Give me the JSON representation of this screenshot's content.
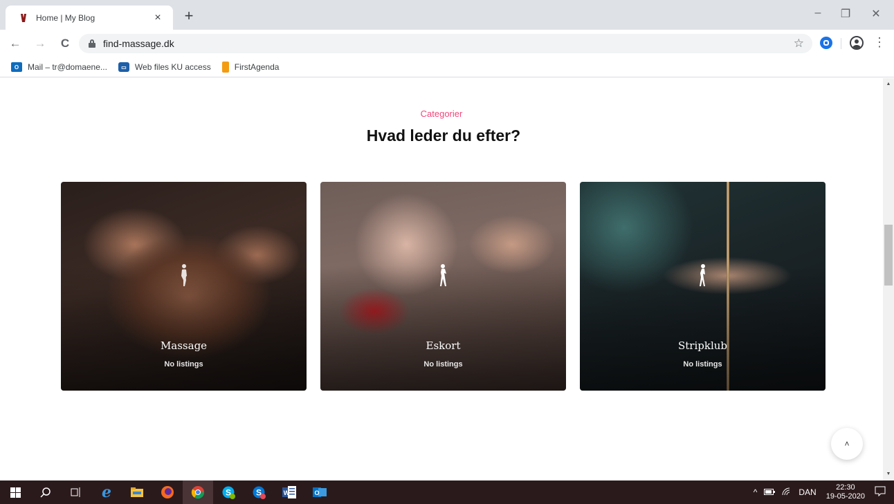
{
  "browser": {
    "tab_title": "Home | My Blog",
    "tab_close": "×",
    "new_tab": "+",
    "url": "find-massage.dk",
    "window_controls": {
      "minimize": "–",
      "restore": "❐",
      "close": "✕"
    },
    "nav": {
      "back": "←",
      "forward": "→",
      "reload": "C"
    },
    "star": "☆",
    "menu": "⋮"
  },
  "bookmarks": [
    {
      "label": "Mail – tr@domaene...",
      "icon": "outlook-icon",
      "color": "#0f6cbd"
    },
    {
      "label": "Web files KU access",
      "icon": "drive-icon",
      "color": "#1d5fa8"
    },
    {
      "label": "FirstAgenda",
      "icon": "firstagenda-icon",
      "color": "#f39c12"
    }
  ],
  "section": {
    "eyebrow": "Categorier",
    "heading": "Hvad leder du efter?"
  },
  "categories": [
    {
      "name": "Massage",
      "count": "No listings"
    },
    {
      "name": "Eskort",
      "count": "No listings"
    },
    {
      "name": "Stripklub",
      "count": "No listings"
    }
  ],
  "back_to_top": "˄",
  "taskbar": {
    "apps": [
      "windows-start-icon",
      "search-icon",
      "task-view-icon",
      "edge-icon",
      "file-explorer-icon",
      "firefox-icon",
      "chrome-icon",
      "skype-icon",
      "skype-business-icon",
      "word-icon",
      "outlook-icon"
    ],
    "tray": {
      "chevron": "^",
      "language": "DAN",
      "time": "22:30",
      "date": "19-05-2020"
    }
  },
  "colors": {
    "accent": "#f0477d",
    "taskbar": "#2b1a1c"
  }
}
